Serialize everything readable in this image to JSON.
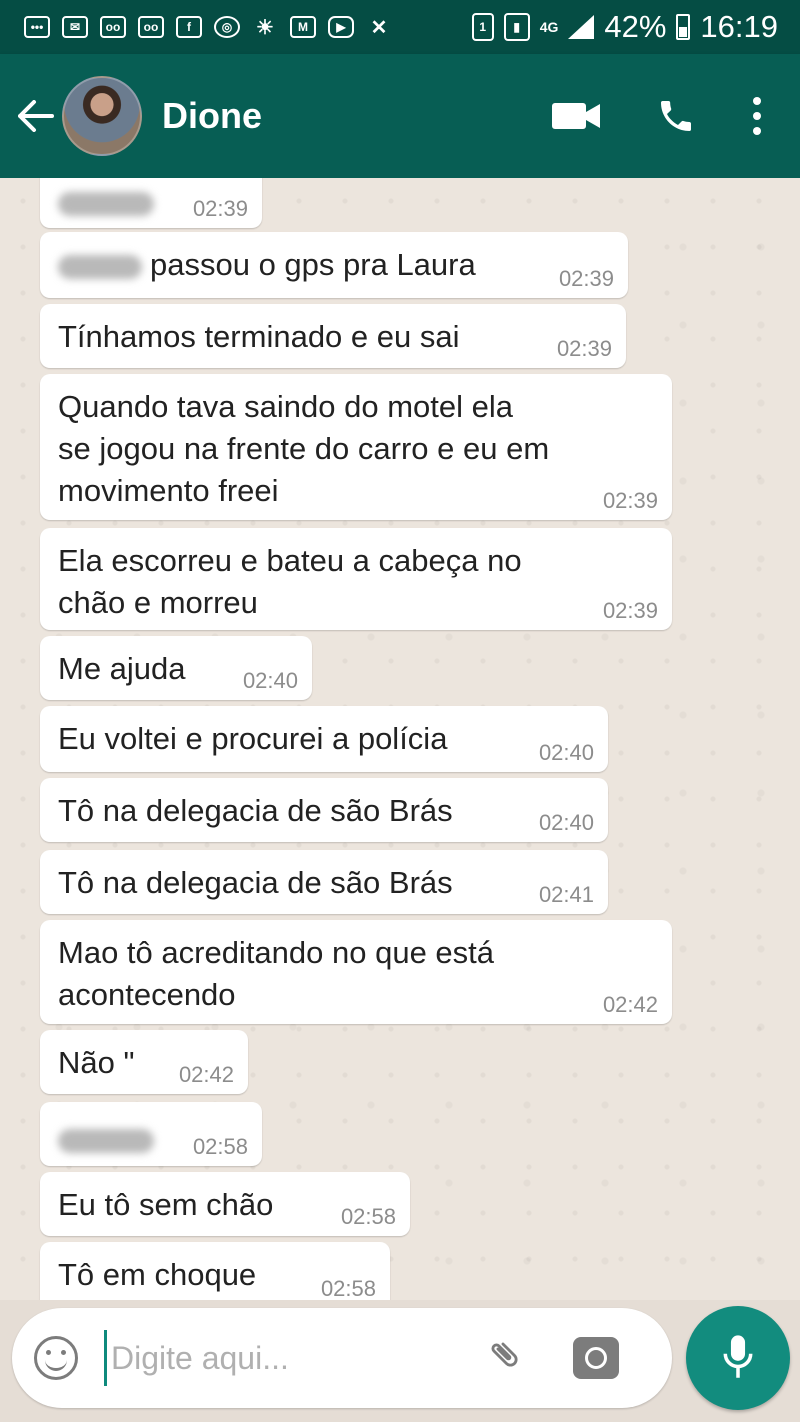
{
  "status_bar": {
    "network_type": "4G",
    "sim": "1",
    "battery_percent": "42%",
    "time": "16:19"
  },
  "header": {
    "contact_name": "Dione",
    "icons": [
      "back-arrow-icon",
      "video-call-icon",
      "phone-call-icon",
      "more-options-icon"
    ]
  },
  "messages": [
    {
      "text": "",
      "redacted": true,
      "time": "02:39"
    },
    {
      "text": "passou o gps pra Laura",
      "redacted_prefix": true,
      "time": "02:39"
    },
    {
      "text": "Tínhamos terminado e eu sai",
      "time": "02:39"
    },
    {
      "text": "Quando tava saindo do motel ela\nse jogou na frente do carro e eu em\nmovimento freei",
      "time": "02:39"
    },
    {
      "text": "Ela escorreu e bateu a cabeça no\nchão e morreu",
      "time": "02:39"
    },
    {
      "text": "Me ajuda",
      "time": "02:40"
    },
    {
      "text": "Eu voltei e procurei a polícia",
      "time": "02:40"
    },
    {
      "text": "Tô na delegacia de são Brás",
      "time": "02:40"
    },
    {
      "text": "Tô na delegacia de são Brás",
      "time": "02:41"
    },
    {
      "text": "Mao tô acreditando no que está\nacontecendo",
      "time": "02:42"
    },
    {
      "text": "Não \"",
      "time": "02:42"
    },
    {
      "text": "",
      "redacted": true,
      "time": "02:58"
    },
    {
      "text": "Eu tô sem chão",
      "time": "02:58"
    },
    {
      "text": "Tô em choque",
      "time": "02:58"
    }
  ],
  "input": {
    "placeholder": "Digite aqui...",
    "value": ""
  },
  "colors": {
    "status_bar": "#054d44",
    "header": "#075e54",
    "chat_background": "#ece5dd",
    "bubble": "#ffffff",
    "mic_button": "#128c7e"
  }
}
